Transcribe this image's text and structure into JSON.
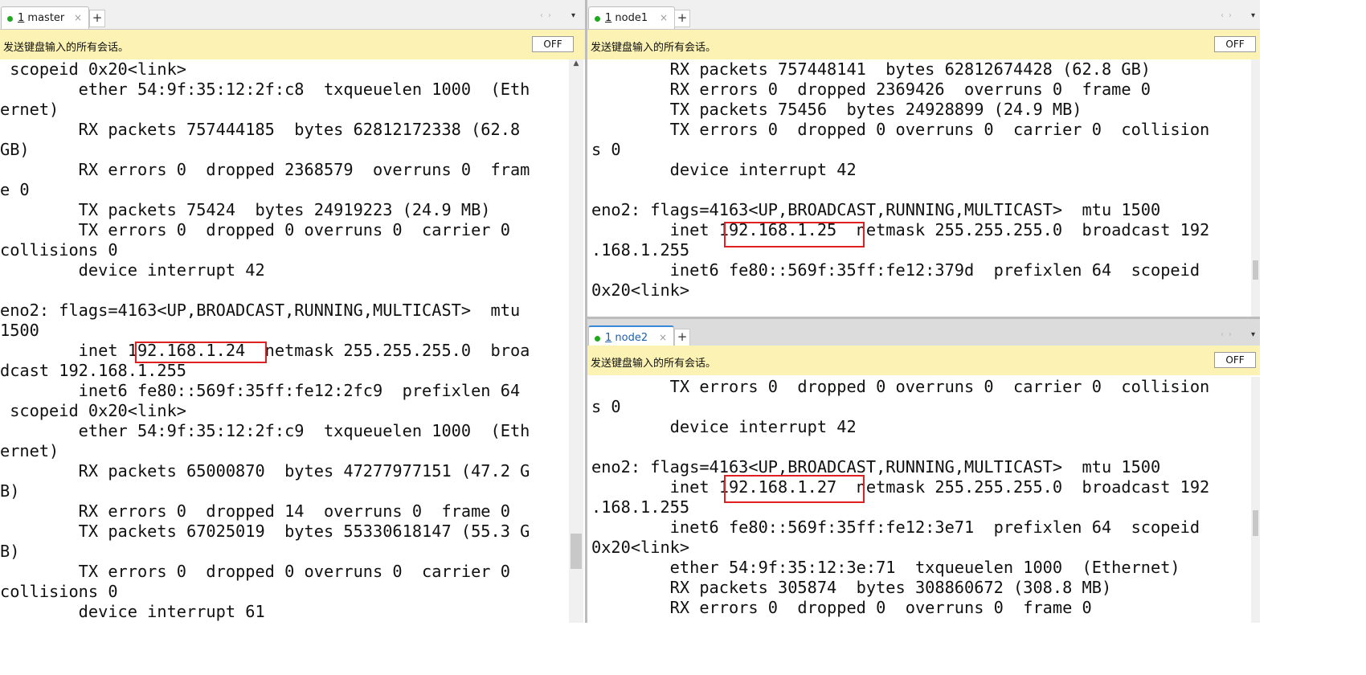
{
  "colors": {
    "highlight_border": "#e02020",
    "tab_dot": "#1fa81f",
    "infobar_bg": "#fbf2b3",
    "active_tab_accent": "#3a88d8"
  },
  "icons": {
    "close": "×",
    "add": "+",
    "scroll_left": "‹",
    "scroll_right": "›",
    "menu": "▾"
  },
  "broadcast_bar": {
    "message": "发送键盘输入的所有会话。",
    "toggle_label": "OFF"
  },
  "sessions": [
    {
      "tab_label": "1 master",
      "highlighted_ip": "192.168.1.24",
      "lines": [
        " scopeid 0x20<link>",
        "        ether 54:9f:35:12:2f:c8  txqueuelen 1000  (Eth",
        "ernet)",
        "        RX packets 757444185  bytes 62812172338 (62.8",
        "GB)",
        "        RX errors 0  dropped 2368579  overruns 0  fram",
        "e 0",
        "        TX packets 75424  bytes 24919223 (24.9 MB)",
        "        TX errors 0  dropped 0 overruns 0  carrier 0",
        "collisions 0",
        "        device interrupt 42",
        "",
        "eno2: flags=4163<UP,BROADCAST,RUNNING,MULTICAST>  mtu",
        "1500",
        "        inet 192.168.1.24  netmask 255.255.255.0  broa",
        "dcast 192.168.1.255",
        "        inet6 fe80::569f:35ff:fe12:2fc9  prefixlen 64",
        " scopeid 0x20<link>",
        "        ether 54:9f:35:12:2f:c9  txqueuelen 1000  (Eth",
        "ernet)",
        "        RX packets 65000870  bytes 47277977151 (47.2 G",
        "B)",
        "        RX errors 0  dropped 14  overruns 0  frame 0",
        "        TX packets 67025019  bytes 55330618147 (55.3 G",
        "B)",
        "        TX errors 0  dropped 0 overruns 0  carrier 0",
        "collisions 0",
        "        device interrupt 61"
      ]
    },
    {
      "tab_label": "1 node1",
      "highlighted_ip": "192.168.1.25",
      "lines": [
        "        RX packets 757448141  bytes 62812674428 (62.8 GB)",
        "        RX errors 0  dropped 2369426  overruns 0  frame 0",
        "        TX packets 75456  bytes 24928899 (24.9 MB)",
        "        TX errors 0  dropped 0 overruns 0  carrier 0  collision",
        "s 0",
        "        device interrupt 42",
        "",
        "eno2: flags=4163<UP,BROADCAST,RUNNING,MULTICAST>  mtu 1500",
        "        inet 192.168.1.25  netmask 255.255.255.0  broadcast 192",
        ".168.1.255",
        "        inet6 fe80::569f:35ff:fe12:379d  prefixlen 64  scopeid",
        "0x20<link>"
      ]
    },
    {
      "tab_label": "1 node2",
      "highlighted_ip": "192.168.1.27",
      "lines": [
        "        TX errors 0  dropped 0 overruns 0  carrier 0  collision",
        "s 0",
        "        device interrupt 42",
        "",
        "eno2: flags=4163<UP,BROADCAST,RUNNING,MULTICAST>  mtu 1500",
        "        inet 192.168.1.27  netmask 255.255.255.0  broadcast 192",
        ".168.1.255",
        "        inet6 fe80::569f:35ff:fe12:3e71  prefixlen 64  scopeid",
        "0x20<link>",
        "        ether 54:9f:35:12:3e:71  txqueuelen 1000  (Ethernet)",
        "        RX packets 305874  bytes 308860672 (308.8 MB)",
        "        RX errors 0  dropped 0  overruns 0  frame 0"
      ]
    }
  ]
}
